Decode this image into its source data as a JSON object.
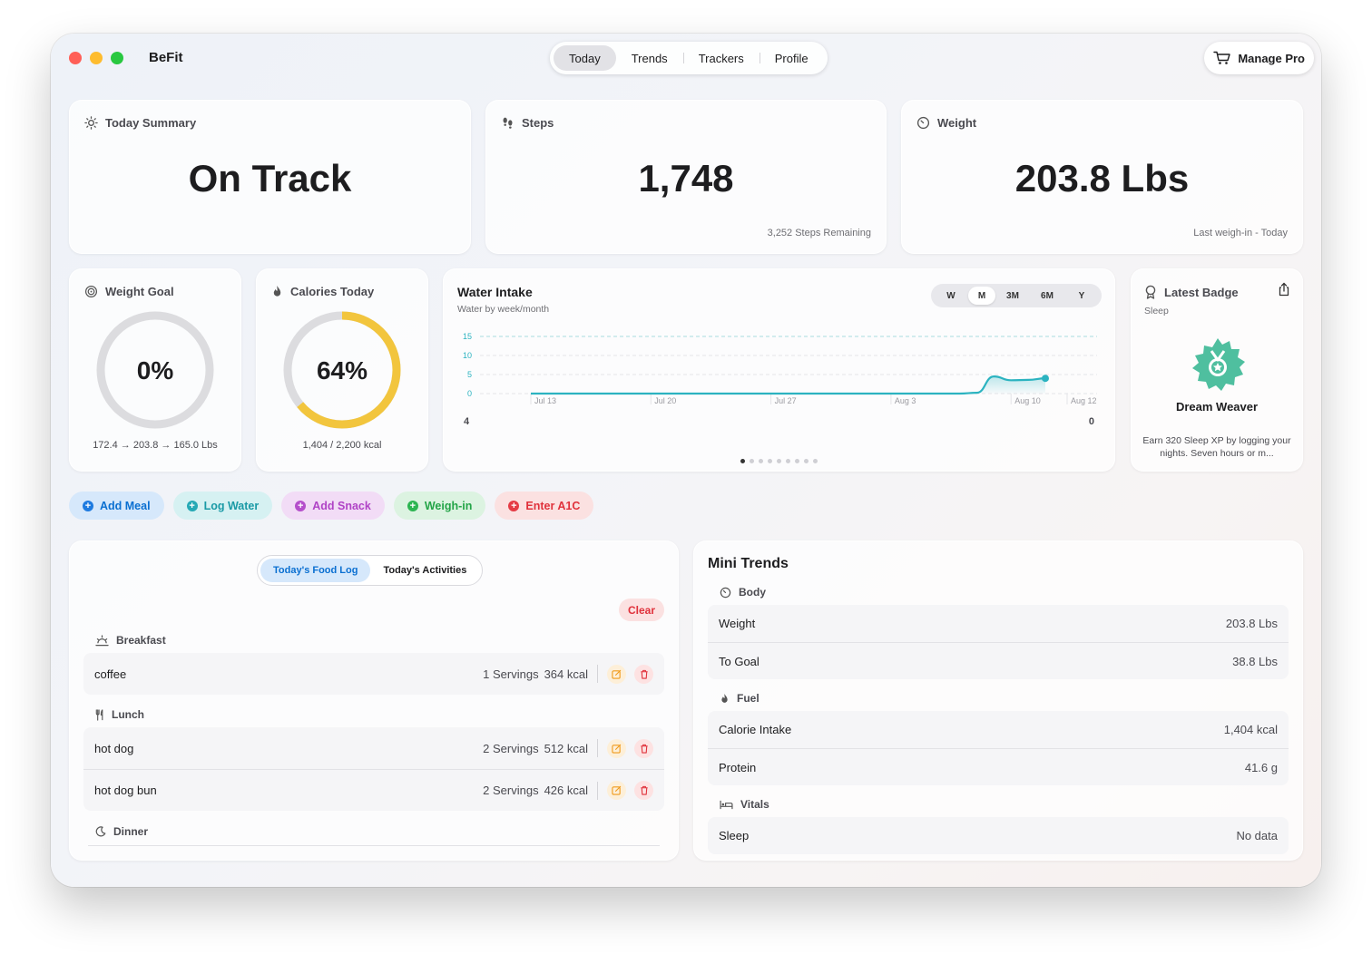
{
  "app": {
    "title": "BeFit"
  },
  "nav": {
    "tabs": [
      "Today",
      "Trends",
      "Trackers",
      "Profile"
    ],
    "active": "Today"
  },
  "header": {
    "pro_label": "Manage Pro"
  },
  "summary": {
    "label": "Today Summary",
    "value": "On Track"
  },
  "steps": {
    "label": "Steps",
    "value": "1,748",
    "sub": "3,252 Steps Remaining"
  },
  "weight": {
    "label": "Weight",
    "value": "203.8 Lbs",
    "sub": "Last weigh-in - Today"
  },
  "weight_goal": {
    "label": "Weight Goal",
    "percent_text": "0%",
    "progress": 0,
    "sub": "172.4 → 203.8 → 165.0 Lbs"
  },
  "calories": {
    "label": "Calories Today",
    "percent_text": "64%",
    "progress": 0.64,
    "sub": "1,404 / 2,200 kcal"
  },
  "water": {
    "title": "Water Intake",
    "subtitle": "Water by week/month",
    "ranges": [
      "W",
      "M",
      "3M",
      "6M",
      "Y"
    ],
    "active_range": "M",
    "left_value": "4",
    "right_value": "0",
    "page_count": 9,
    "active_page": 0
  },
  "chart_data": {
    "type": "line",
    "title": "Water Intake",
    "yticks": [
      0,
      5,
      10,
      15
    ],
    "ylim": [
      0,
      15
    ],
    "x_tick_labels": [
      "Jul 13",
      "Jul 20",
      "Jul 27",
      "Aug 3",
      "Aug 10",
      "Aug 12"
    ],
    "x": [
      "Jul 13",
      "Jul 20",
      "Jul 27",
      "Aug 3",
      "Aug 7",
      "Aug 8",
      "Aug 9",
      "Aug 10",
      "Aug 11",
      "Aug 12"
    ],
    "values": [
      0,
      0,
      0,
      0,
      0,
      0.2,
      4.5,
      3.5,
      3.6,
      4
    ],
    "color": "#2bb3c0",
    "grid": true
  },
  "badge": {
    "label": "Latest Badge",
    "category": "Sleep",
    "name": "Dream Weaver",
    "desc": "Earn 320 Sleep XP by logging your nights. Seven hours or m..."
  },
  "actions": [
    {
      "label": "Add Meal",
      "bg": "#d6e8fb",
      "fg": "#0a6fd1",
      "dot": "#1e7be0"
    },
    {
      "label": "Log Water",
      "bg": "#d6f1f2",
      "fg": "#1a9aa6",
      "dot": "#25a9b5"
    },
    {
      "label": "Add Snack",
      "bg": "#f2dcf6",
      "fg": "#b043c6",
      "dot": "#b54fcb"
    },
    {
      "label": "Weigh-in",
      "bg": "#dcf3e1",
      "fg": "#23a447",
      "dot": "#2db552"
    },
    {
      "label": "Enter A1C",
      "bg": "#fbe1e1",
      "fg": "#e0313b",
      "dot": "#e53b45"
    }
  ],
  "food_log": {
    "tabs": [
      "Today's Food Log",
      "Today's Activities"
    ],
    "active_tab": 0,
    "clear_label": "Clear",
    "meals": [
      {
        "name": "Breakfast",
        "items": [
          {
            "name": "coffee",
            "servings": "1 Servings",
            "kcal": "364 kcal"
          }
        ]
      },
      {
        "name": "Lunch",
        "items": [
          {
            "name": "hot dog",
            "servings": "2 Servings",
            "kcal": "512 kcal"
          },
          {
            "name": "hot dog bun",
            "servings": "2 Servings",
            "kcal": "426 kcal"
          }
        ]
      },
      {
        "name": "Dinner",
        "items": []
      }
    ]
  },
  "mini_trends": {
    "title": "Mini Trends",
    "sections": [
      {
        "name": "Body",
        "rows": [
          {
            "label": "Weight",
            "value": "203.8 Lbs"
          },
          {
            "label": "To Goal",
            "value": "38.8 Lbs"
          }
        ]
      },
      {
        "name": "Fuel",
        "rows": [
          {
            "label": "Calorie Intake",
            "value": "1,404 kcal"
          },
          {
            "label": "Protein",
            "value": "41.6 g"
          }
        ]
      },
      {
        "name": "Vitals",
        "rows": [
          {
            "label": "Sleep",
            "value": "No data"
          }
        ]
      }
    ]
  }
}
